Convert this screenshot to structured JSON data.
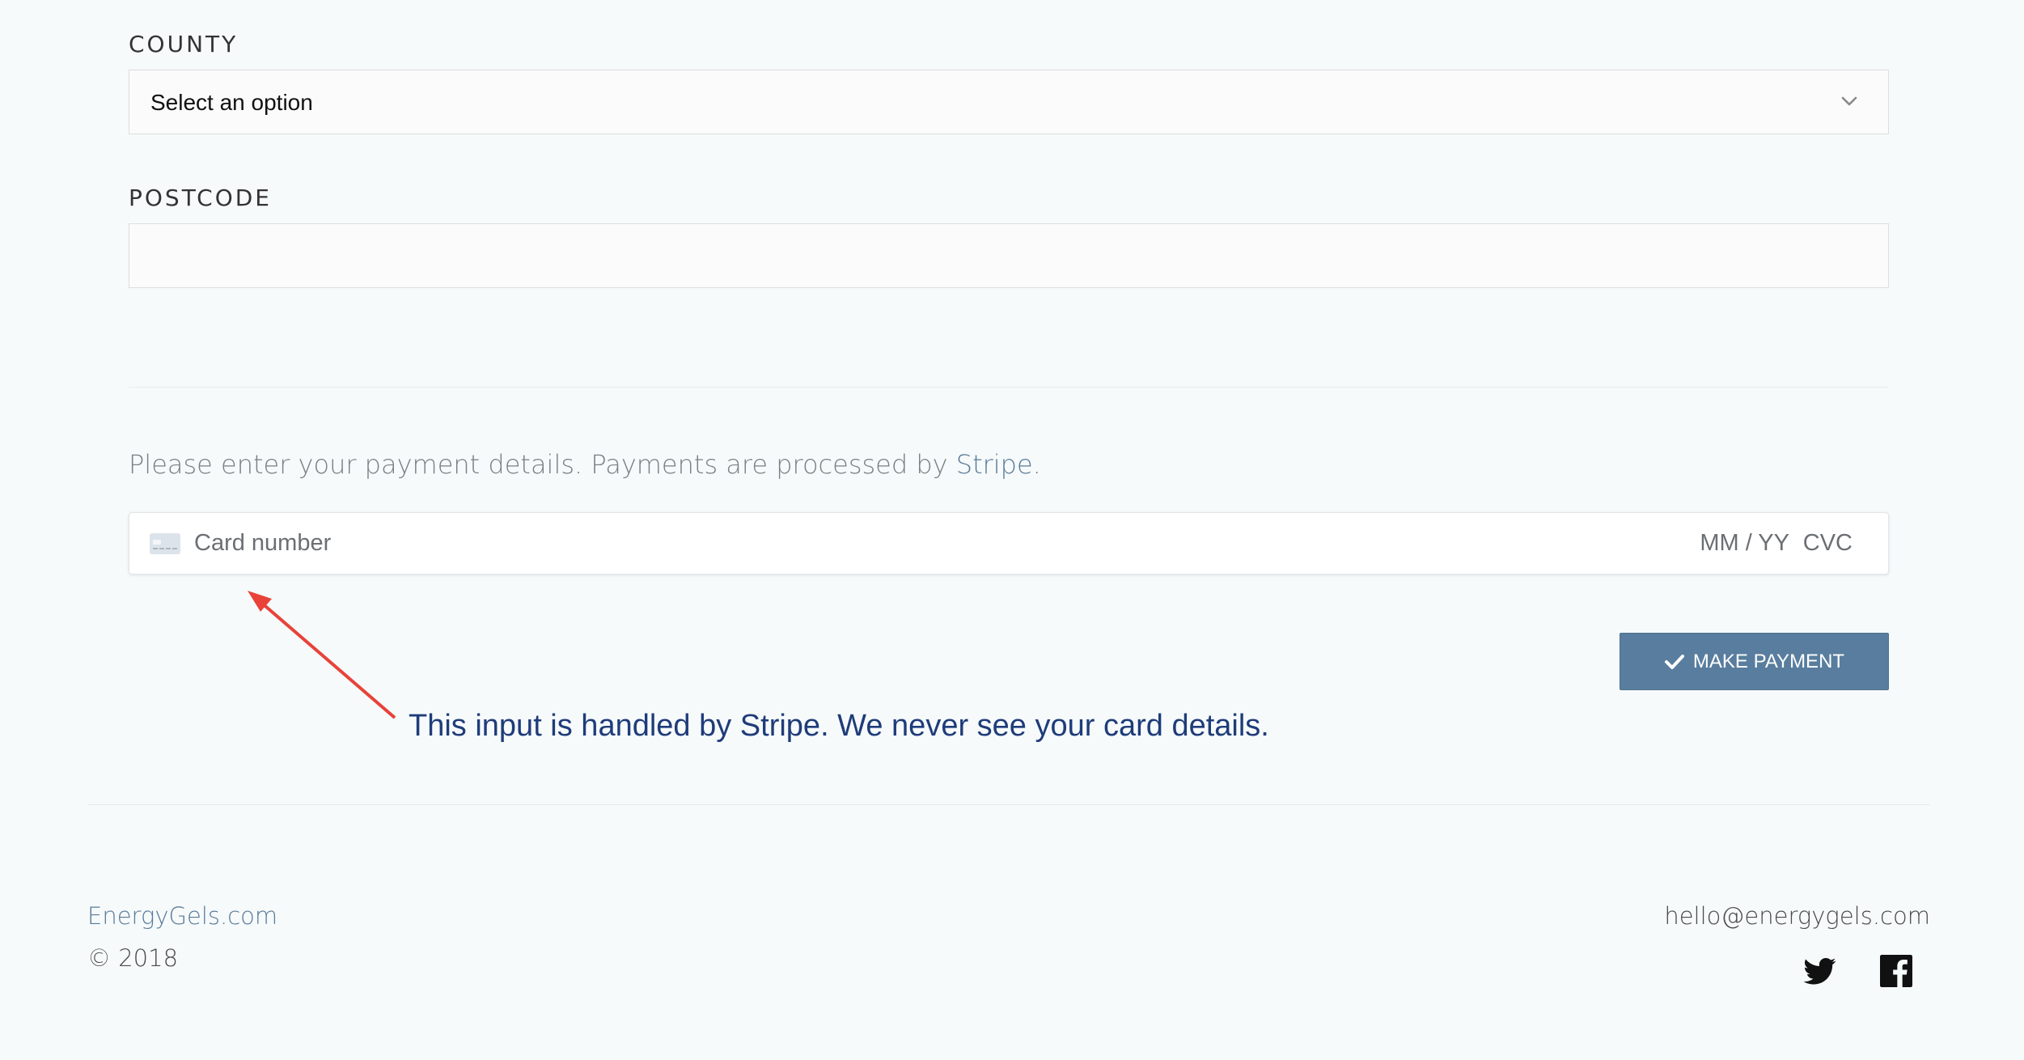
{
  "form": {
    "county": {
      "label": "COUNTY",
      "selected_value": "Select an option"
    },
    "postcode": {
      "label": "POSTCODE",
      "value": ""
    }
  },
  "payment": {
    "intro_text": "Please enter your payment details. Payments are processed by ",
    "stripe_link": "Stripe",
    "intro_suffix": ".",
    "card": {
      "icon": "credit-card-icon",
      "number_placeholder": "Card number",
      "expiry_placeholder": "MM / YY",
      "cvc_placeholder": "CVC"
    },
    "button": {
      "icon": "checkmark-icon",
      "label": "MAKE PAYMENT"
    },
    "annotation": "This input is handled by Stripe. We never see your card details."
  },
  "footer": {
    "brand": "EnergyGels.com",
    "copyright": "© 2018",
    "email": "hello@energygels.com",
    "social": [
      {
        "icon": "twitter-icon"
      },
      {
        "icon": "facebook-icon"
      }
    ]
  },
  "colors": {
    "background": "#f6fafa",
    "accent": "#587d9e",
    "link": "#5a7b9a",
    "annotation": "#1f3c7a",
    "arrow": "#e8423a"
  }
}
